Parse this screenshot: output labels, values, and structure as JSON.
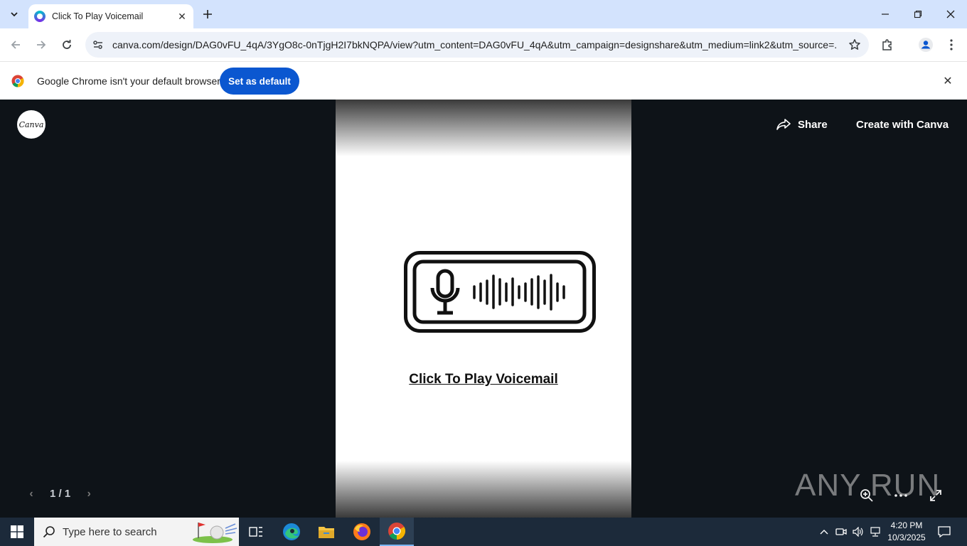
{
  "browser": {
    "tab_title": "Click To Play Voicemail",
    "url": "canva.com/design/DAG0vFU_4qA/3YgO8c-0nTjgH2I7bkNQPA/view?utm_content=DAG0vFU_4qA&utm_campaign=designshare&utm_medium=link2&utm_source=..."
  },
  "infobar": {
    "message": "Google Chrome isn't your default browser",
    "set_default_label": "Set as default"
  },
  "viewer": {
    "logo_text": "Canva",
    "share_label": "Share",
    "create_label": "Create with Canva",
    "page_indicator": "1 / 1",
    "watermark": "ANY RUN"
  },
  "design": {
    "link_text": "Click To Play Voicemail"
  },
  "taskbar": {
    "search_placeholder": "Type here to search",
    "time": "4:20 PM",
    "date": "10/3/2025"
  },
  "colors": {
    "tabstrip": "#d3e3fd",
    "set_default_button": "#0b57d0",
    "viewer_bg": "#0e1318",
    "taskbar": "#1c2a3a"
  }
}
